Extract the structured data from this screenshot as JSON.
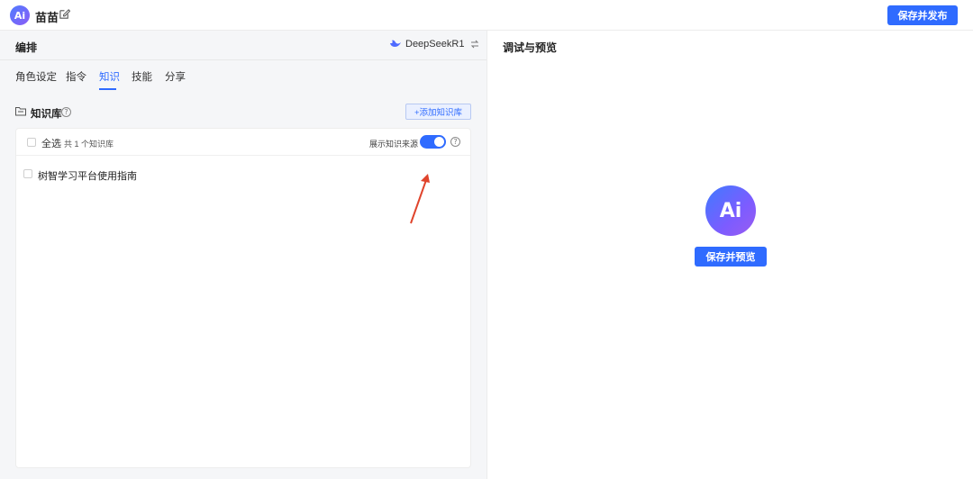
{
  "app": {
    "logo_text": "Ai",
    "name": "苗苗",
    "edit_icon": "edit-icon"
  },
  "toolbar": {
    "publish_label": "保存并发布"
  },
  "left": {
    "title": "编排",
    "model": {
      "name": "DeepSeekR1",
      "icon": "whale-icon",
      "swap_icon": "swap-icon"
    },
    "tabs": [
      {
        "label": "角色设定",
        "active": false
      },
      {
        "label": "指令",
        "active": false
      },
      {
        "label": "知识",
        "active": true
      },
      {
        "label": "技能",
        "active": false
      },
      {
        "label": "分享",
        "active": false
      }
    ],
    "knowledge": {
      "title": "知识库",
      "add_button": "+添加知识库",
      "select_all": "全选",
      "count_text": "共 1 个知识库",
      "show_source_label": "展示知识来源",
      "show_source_enabled": true,
      "items": [
        {
          "label": "树智学习平台使用指南",
          "checked": false
        }
      ]
    }
  },
  "right": {
    "title": "调试与预览",
    "avatar_text": "Ai",
    "save_preview_label": "保存并预览"
  },
  "colors": {
    "primary": "#2f6bff",
    "annotation_arrow": "#e0442c"
  }
}
